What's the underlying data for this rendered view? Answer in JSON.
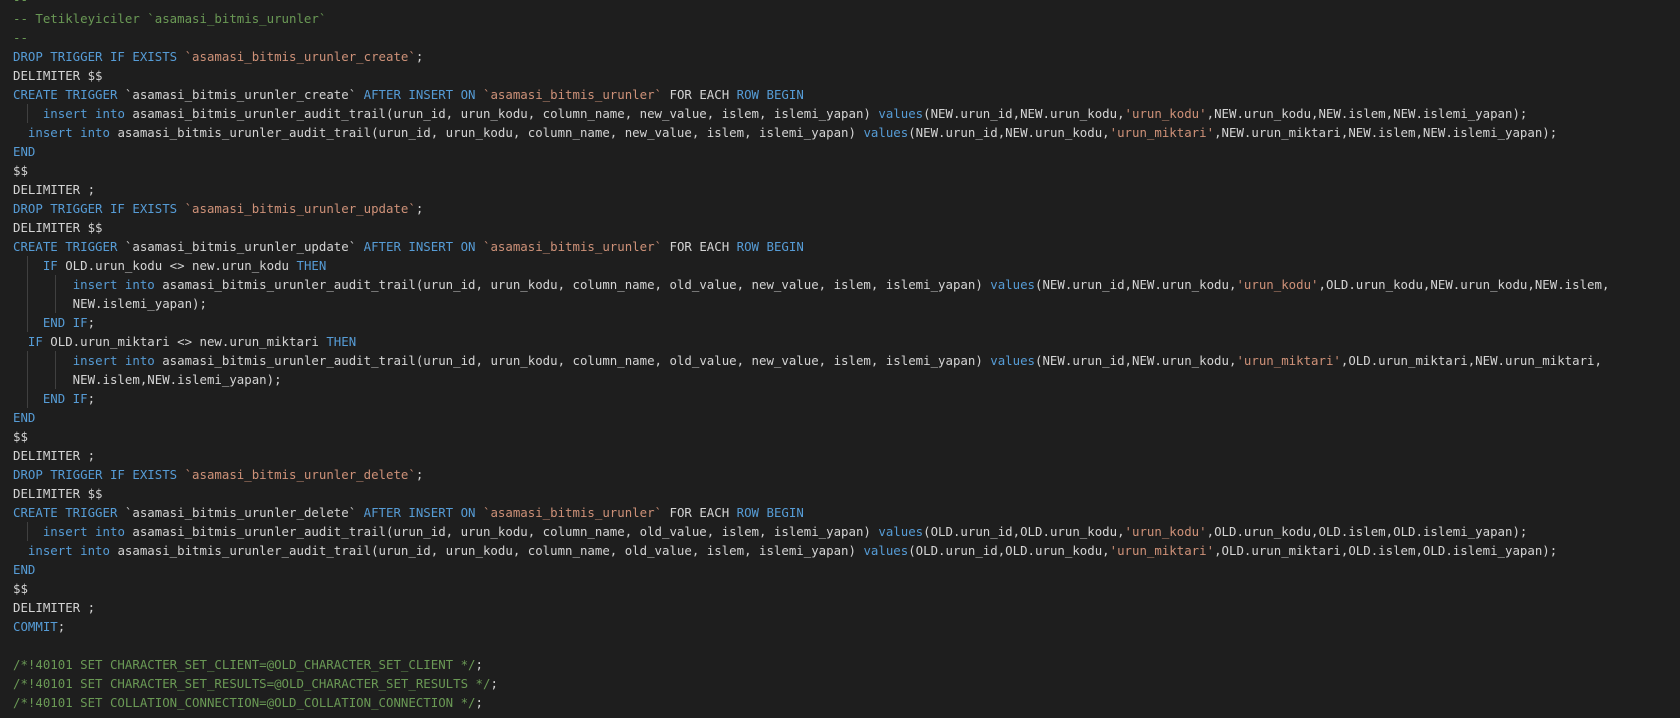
{
  "editor": {
    "theme_colors": {
      "background": "#1e1e1e",
      "default": "#d4d4d4",
      "comment": "#6a9955",
      "keyword": "#569cd6",
      "string": "#ce9178",
      "indent_guide": "#404040"
    },
    "lines": [
      {
        "indent": 0,
        "tokens": [
          {
            "t": "c",
            "v": "--"
          }
        ]
      },
      {
        "indent": 0,
        "tokens": [
          {
            "t": "c",
            "v": "-- Tetikleyiciler `asamasi_bitmis_urunler`"
          }
        ]
      },
      {
        "indent": 0,
        "tokens": [
          {
            "t": "c",
            "v": "--"
          }
        ]
      },
      {
        "indent": 0,
        "tokens": [
          {
            "t": "k",
            "v": "DROP TRIGGER IF EXISTS "
          },
          {
            "t": "s",
            "v": "`asamasi_bitmis_urunler_create`"
          },
          {
            "t": "p",
            "v": ";"
          }
        ]
      },
      {
        "indent": 0,
        "tokens": [
          {
            "t": "p",
            "v": "DELIMITER $$"
          }
        ]
      },
      {
        "indent": 0,
        "tokens": [
          {
            "t": "k",
            "v": "CREATE TRIGGER "
          },
          {
            "t": "p",
            "v": "`asamasi_bitmis_urunler_create` "
          },
          {
            "t": "k",
            "v": "AFTER INSERT ON "
          },
          {
            "t": "s",
            "v": "`asamasi_bitmis_urunler`"
          },
          {
            "t": "p",
            "v": " FOR EACH "
          },
          {
            "t": "k",
            "v": "ROW BEGIN"
          }
        ]
      },
      {
        "indent": 1,
        "tokens": [
          {
            "t": "p",
            "v": "    "
          },
          {
            "t": "k",
            "v": "insert into"
          },
          {
            "t": "p",
            "v": " asamasi_bitmis_urunler_audit_trail(urun_id, urun_kodu, column_name, new_value, islem, islemi_yapan) "
          },
          {
            "t": "k",
            "v": "values"
          },
          {
            "t": "p",
            "v": "(NEW.urun_id,NEW.urun_kodu,"
          },
          {
            "t": "s",
            "v": "'urun_kodu'"
          },
          {
            "t": "p",
            "v": ",NEW.urun_kodu,NEW.islem,NEW.islemi_yapan);"
          }
        ]
      },
      {
        "indent": 0,
        "tokens": [
          {
            "t": "p",
            "v": "  "
          },
          {
            "t": "k",
            "v": "insert into"
          },
          {
            "t": "p",
            "v": " asamasi_bitmis_urunler_audit_trail(urun_id, urun_kodu, column_name, new_value, islem, islemi_yapan) "
          },
          {
            "t": "k",
            "v": "values"
          },
          {
            "t": "p",
            "v": "(NEW.urun_id,NEW.urun_kodu,"
          },
          {
            "t": "s",
            "v": "'urun_miktari'"
          },
          {
            "t": "p",
            "v": ",NEW.urun_miktari,NEW.islem,NEW.islemi_yapan);"
          }
        ]
      },
      {
        "indent": 0,
        "tokens": [
          {
            "t": "k",
            "v": "END"
          }
        ]
      },
      {
        "indent": 0,
        "tokens": [
          {
            "t": "p",
            "v": "$$"
          }
        ]
      },
      {
        "indent": 0,
        "tokens": [
          {
            "t": "p",
            "v": "DELIMITER ;"
          }
        ]
      },
      {
        "indent": 0,
        "tokens": [
          {
            "t": "k",
            "v": "DROP TRIGGER IF EXISTS "
          },
          {
            "t": "s",
            "v": "`asamasi_bitmis_urunler_update`"
          },
          {
            "t": "p",
            "v": ";"
          }
        ]
      },
      {
        "indent": 0,
        "tokens": [
          {
            "t": "p",
            "v": "DELIMITER $$"
          }
        ]
      },
      {
        "indent": 0,
        "tokens": [
          {
            "t": "k",
            "v": "CREATE TRIGGER "
          },
          {
            "t": "p",
            "v": "`asamasi_bitmis_urunler_update` "
          },
          {
            "t": "k",
            "v": "AFTER INSERT ON "
          },
          {
            "t": "s",
            "v": "`asamasi_bitmis_urunler`"
          },
          {
            "t": "p",
            "v": " FOR EACH "
          },
          {
            "t": "k",
            "v": "ROW BEGIN"
          }
        ]
      },
      {
        "indent": 1,
        "tokens": [
          {
            "t": "p",
            "v": "    "
          },
          {
            "t": "k",
            "v": "IF"
          },
          {
            "t": "p",
            "v": " OLD.urun_kodu <> new.urun_kodu "
          },
          {
            "t": "k",
            "v": "THEN"
          }
        ]
      },
      {
        "indent": 2,
        "tokens": [
          {
            "t": "p",
            "v": "        "
          },
          {
            "t": "k",
            "v": "insert into"
          },
          {
            "t": "p",
            "v": " asamasi_bitmis_urunler_audit_trail(urun_id, urun_kodu, column_name, old_value, new_value, islem, islemi_yapan) "
          },
          {
            "t": "k",
            "v": "values"
          },
          {
            "t": "p",
            "v": "(NEW.urun_id,NEW.urun_kodu,"
          },
          {
            "t": "s",
            "v": "'urun_kodu'"
          },
          {
            "t": "p",
            "v": ",OLD.urun_kodu,NEW.urun_kodu,NEW.islem,"
          }
        ]
      },
      {
        "indent": 2,
        "tokens": [
          {
            "t": "p",
            "v": "        NEW.islemi_yapan);"
          }
        ]
      },
      {
        "indent": 1,
        "tokens": [
          {
            "t": "p",
            "v": "    "
          },
          {
            "t": "k",
            "v": "END IF"
          },
          {
            "t": "p",
            "v": ";"
          }
        ]
      },
      {
        "indent": 0,
        "tokens": [
          {
            "t": "p",
            "v": "  "
          },
          {
            "t": "k",
            "v": "IF"
          },
          {
            "t": "p",
            "v": " OLD.urun_miktari <> new.urun_miktari "
          },
          {
            "t": "k",
            "v": "THEN"
          }
        ]
      },
      {
        "indent": 2,
        "tokens": [
          {
            "t": "p",
            "v": "        "
          },
          {
            "t": "k",
            "v": "insert into"
          },
          {
            "t": "p",
            "v": " asamasi_bitmis_urunler_audit_trail(urun_id, urun_kodu, column_name, old_value, new_value, islem, islemi_yapan) "
          },
          {
            "t": "k",
            "v": "values"
          },
          {
            "t": "p",
            "v": "(NEW.urun_id,NEW.urun_kodu,"
          },
          {
            "t": "s",
            "v": "'urun_miktari'"
          },
          {
            "t": "p",
            "v": ",OLD.urun_miktari,NEW.urun_miktari,"
          }
        ]
      },
      {
        "indent": 2,
        "tokens": [
          {
            "t": "p",
            "v": "        NEW.islem,NEW.islemi_yapan);"
          }
        ]
      },
      {
        "indent": 1,
        "tokens": [
          {
            "t": "p",
            "v": "    "
          },
          {
            "t": "k",
            "v": "END IF"
          },
          {
            "t": "p",
            "v": ";"
          }
        ]
      },
      {
        "indent": 0,
        "tokens": [
          {
            "t": "k",
            "v": "END"
          }
        ]
      },
      {
        "indent": 0,
        "tokens": [
          {
            "t": "p",
            "v": "$$"
          }
        ]
      },
      {
        "indent": 0,
        "tokens": [
          {
            "t": "p",
            "v": "DELIMITER ;"
          }
        ]
      },
      {
        "indent": 0,
        "tokens": [
          {
            "t": "k",
            "v": "DROP TRIGGER IF EXISTS "
          },
          {
            "t": "s",
            "v": "`asamasi_bitmis_urunler_delete`"
          },
          {
            "t": "p",
            "v": ";"
          }
        ]
      },
      {
        "indent": 0,
        "tokens": [
          {
            "t": "p",
            "v": "DELIMITER $$"
          }
        ]
      },
      {
        "indent": 0,
        "tokens": [
          {
            "t": "k",
            "v": "CREATE TRIGGER "
          },
          {
            "t": "p",
            "v": "`asamasi_bitmis_urunler_delete` "
          },
          {
            "t": "k",
            "v": "AFTER INSERT ON "
          },
          {
            "t": "s",
            "v": "`asamasi_bitmis_urunler`"
          },
          {
            "t": "p",
            "v": " FOR EACH "
          },
          {
            "t": "k",
            "v": "ROW BEGIN"
          }
        ]
      },
      {
        "indent": 1,
        "tokens": [
          {
            "t": "p",
            "v": "    "
          },
          {
            "t": "k",
            "v": "insert into"
          },
          {
            "t": "p",
            "v": " asamasi_bitmis_urunler_audit_trail(urun_id, urun_kodu, column_name, old_value, islem, islemi_yapan) "
          },
          {
            "t": "k",
            "v": "values"
          },
          {
            "t": "p",
            "v": "(OLD.urun_id,OLD.urun_kodu,"
          },
          {
            "t": "s",
            "v": "'urun_kodu'"
          },
          {
            "t": "p",
            "v": ",OLD.urun_kodu,OLD.islem,OLD.islemi_yapan);"
          }
        ]
      },
      {
        "indent": 0,
        "tokens": [
          {
            "t": "p",
            "v": "  "
          },
          {
            "t": "k",
            "v": "insert into"
          },
          {
            "t": "p",
            "v": " asamasi_bitmis_urunler_audit_trail(urun_id, urun_kodu, column_name, old_value, islem, islemi_yapan) "
          },
          {
            "t": "k",
            "v": "values"
          },
          {
            "t": "p",
            "v": "(OLD.urun_id,OLD.urun_kodu,"
          },
          {
            "t": "s",
            "v": "'urun_miktari'"
          },
          {
            "t": "p",
            "v": ",OLD.urun_miktari,OLD.islem,OLD.islemi_yapan);"
          }
        ]
      },
      {
        "indent": 0,
        "tokens": [
          {
            "t": "k",
            "v": "END"
          }
        ]
      },
      {
        "indent": 0,
        "tokens": [
          {
            "t": "p",
            "v": "$$"
          }
        ]
      },
      {
        "indent": 0,
        "tokens": [
          {
            "t": "p",
            "v": "DELIMITER ;"
          }
        ]
      },
      {
        "indent": 0,
        "tokens": [
          {
            "t": "k",
            "v": "COMMIT"
          },
          {
            "t": "p",
            "v": ";"
          }
        ]
      },
      {
        "indent": 0,
        "tokens": []
      },
      {
        "indent": 0,
        "tokens": [
          {
            "t": "c",
            "v": "/*!40101 SET CHARACTER_SET_CLIENT=@OLD_CHARACTER_SET_CLIENT */"
          },
          {
            "t": "p",
            "v": ";"
          }
        ]
      },
      {
        "indent": 0,
        "tokens": [
          {
            "t": "c",
            "v": "/*!40101 SET CHARACTER_SET_RESULTS=@OLD_CHARACTER_SET_RESULTS */"
          },
          {
            "t": "p",
            "v": ";"
          }
        ]
      },
      {
        "indent": 0,
        "tokens": [
          {
            "t": "c",
            "v": "/*!40101 SET COLLATION_CONNECTION=@OLD_COLLATION_CONNECTION */"
          },
          {
            "t": "p",
            "v": ";"
          }
        ]
      }
    ]
  }
}
